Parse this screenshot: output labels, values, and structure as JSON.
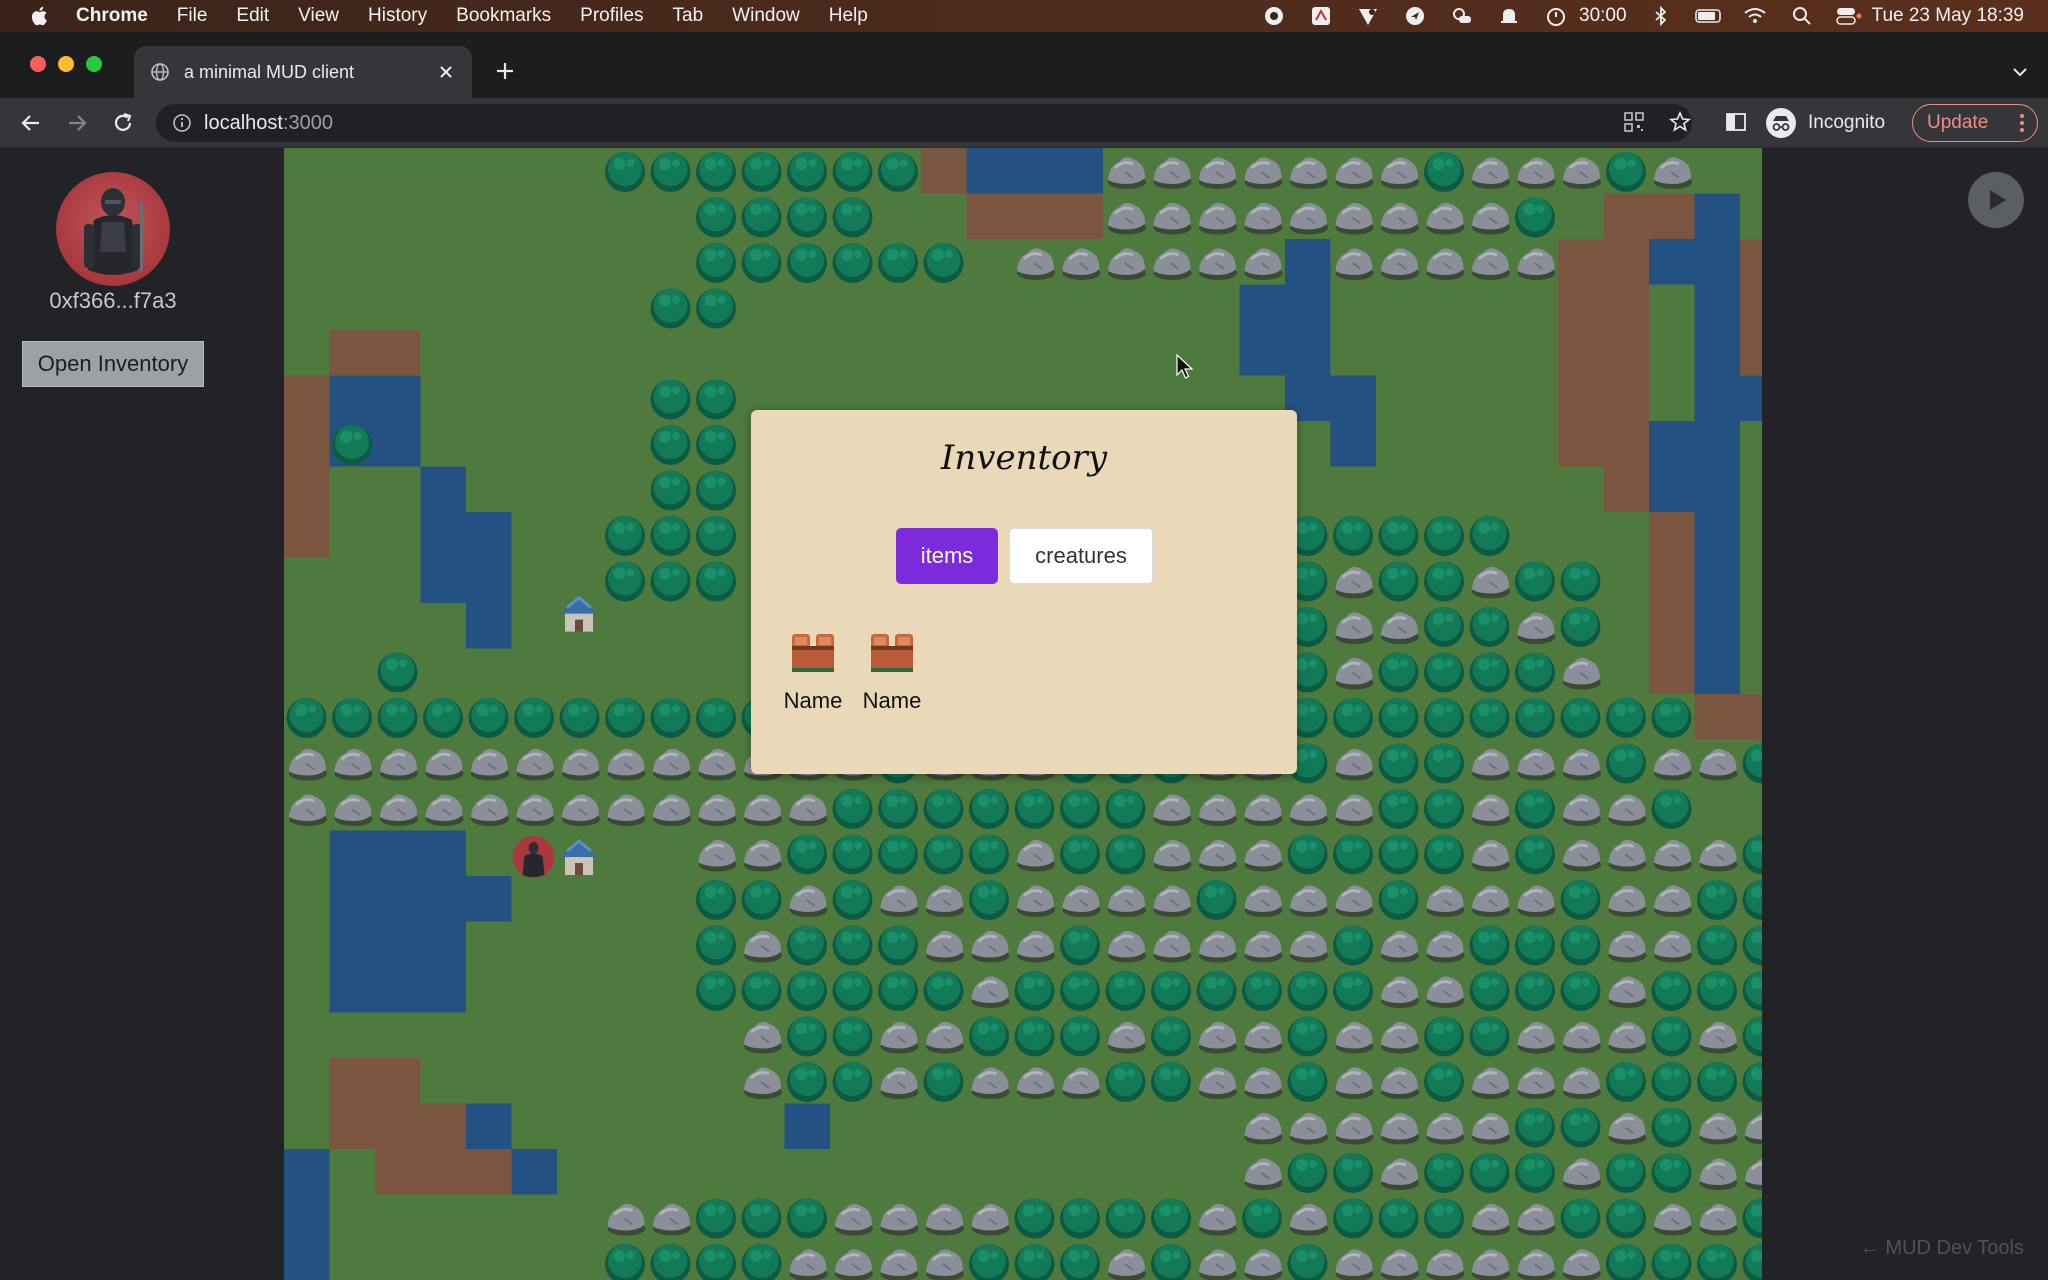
{
  "menubar": {
    "app_name": "Chrome",
    "items": [
      "File",
      "Edit",
      "View",
      "History",
      "Bookmarks",
      "Profiles",
      "Tab",
      "Window",
      "Help"
    ],
    "timer": "30:00",
    "datetime": "Tue 23 May  18:39",
    "icons": [
      "record-icon",
      "pdf-icon",
      "vpn-icon",
      "location-icon",
      "weather-icon",
      "notification-icon",
      "timer-icon",
      "bluetooth-icon",
      "battery-icon",
      "wifi-icon",
      "spotlight-icon",
      "control-center-icon"
    ]
  },
  "browser": {
    "tab_title": "a minimal MUD client",
    "url_host": "localhost",
    "url_port": ":3000",
    "profile_label": "Incognito",
    "update_label": "Update"
  },
  "sidebar": {
    "address": "0xf366...f7a3",
    "open_inventory_label": "Open Inventory"
  },
  "inventory": {
    "title": "Inventory",
    "tabs": [
      {
        "label": "items",
        "active": true
      },
      {
        "label": "creatures",
        "active": false
      }
    ],
    "items": [
      {
        "label": "Name",
        "icon": "chest-icon"
      },
      {
        "label": "Name",
        "icon": "chest-icon"
      }
    ]
  },
  "devtools": {
    "label": "← MUD Dev Tools"
  },
  "colors": {
    "grass": "#4e7a3e",
    "water": "#235182",
    "dirt": "#7a5640",
    "accent": "#7c2bdc",
    "modal_bg": "#e9d9b8"
  }
}
